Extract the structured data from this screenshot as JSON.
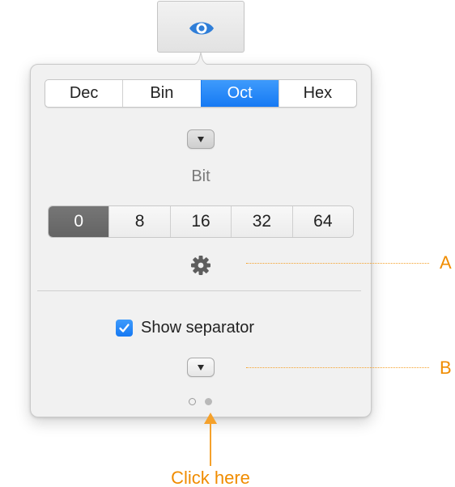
{
  "toolbar": {
    "icon": "eye-icon"
  },
  "popover": {
    "base_tabs": [
      {
        "label": "Dec",
        "selected": false
      },
      {
        "label": "Bin",
        "selected": false
      },
      {
        "label": "Oct",
        "selected": true
      },
      {
        "label": "Hex",
        "selected": false
      }
    ],
    "bit_label": "Bit",
    "bit_options": [
      {
        "label": "0",
        "selected": true
      },
      {
        "label": "8",
        "selected": false
      },
      {
        "label": "16",
        "selected": false
      },
      {
        "label": "32",
        "selected": false
      },
      {
        "label": "64",
        "selected": false
      }
    ],
    "settings_icon": "gear-icon",
    "show_separator": {
      "label": "Show separator",
      "checked": true
    },
    "page_dots": {
      "count": 2,
      "current": 2
    }
  },
  "annotations": {
    "a": "A",
    "b": "B",
    "click_here": "Click here"
  },
  "colors": {
    "accent": "#1679f3",
    "annotation": "#f08c00",
    "eye_icon": "#2f7ed8"
  }
}
